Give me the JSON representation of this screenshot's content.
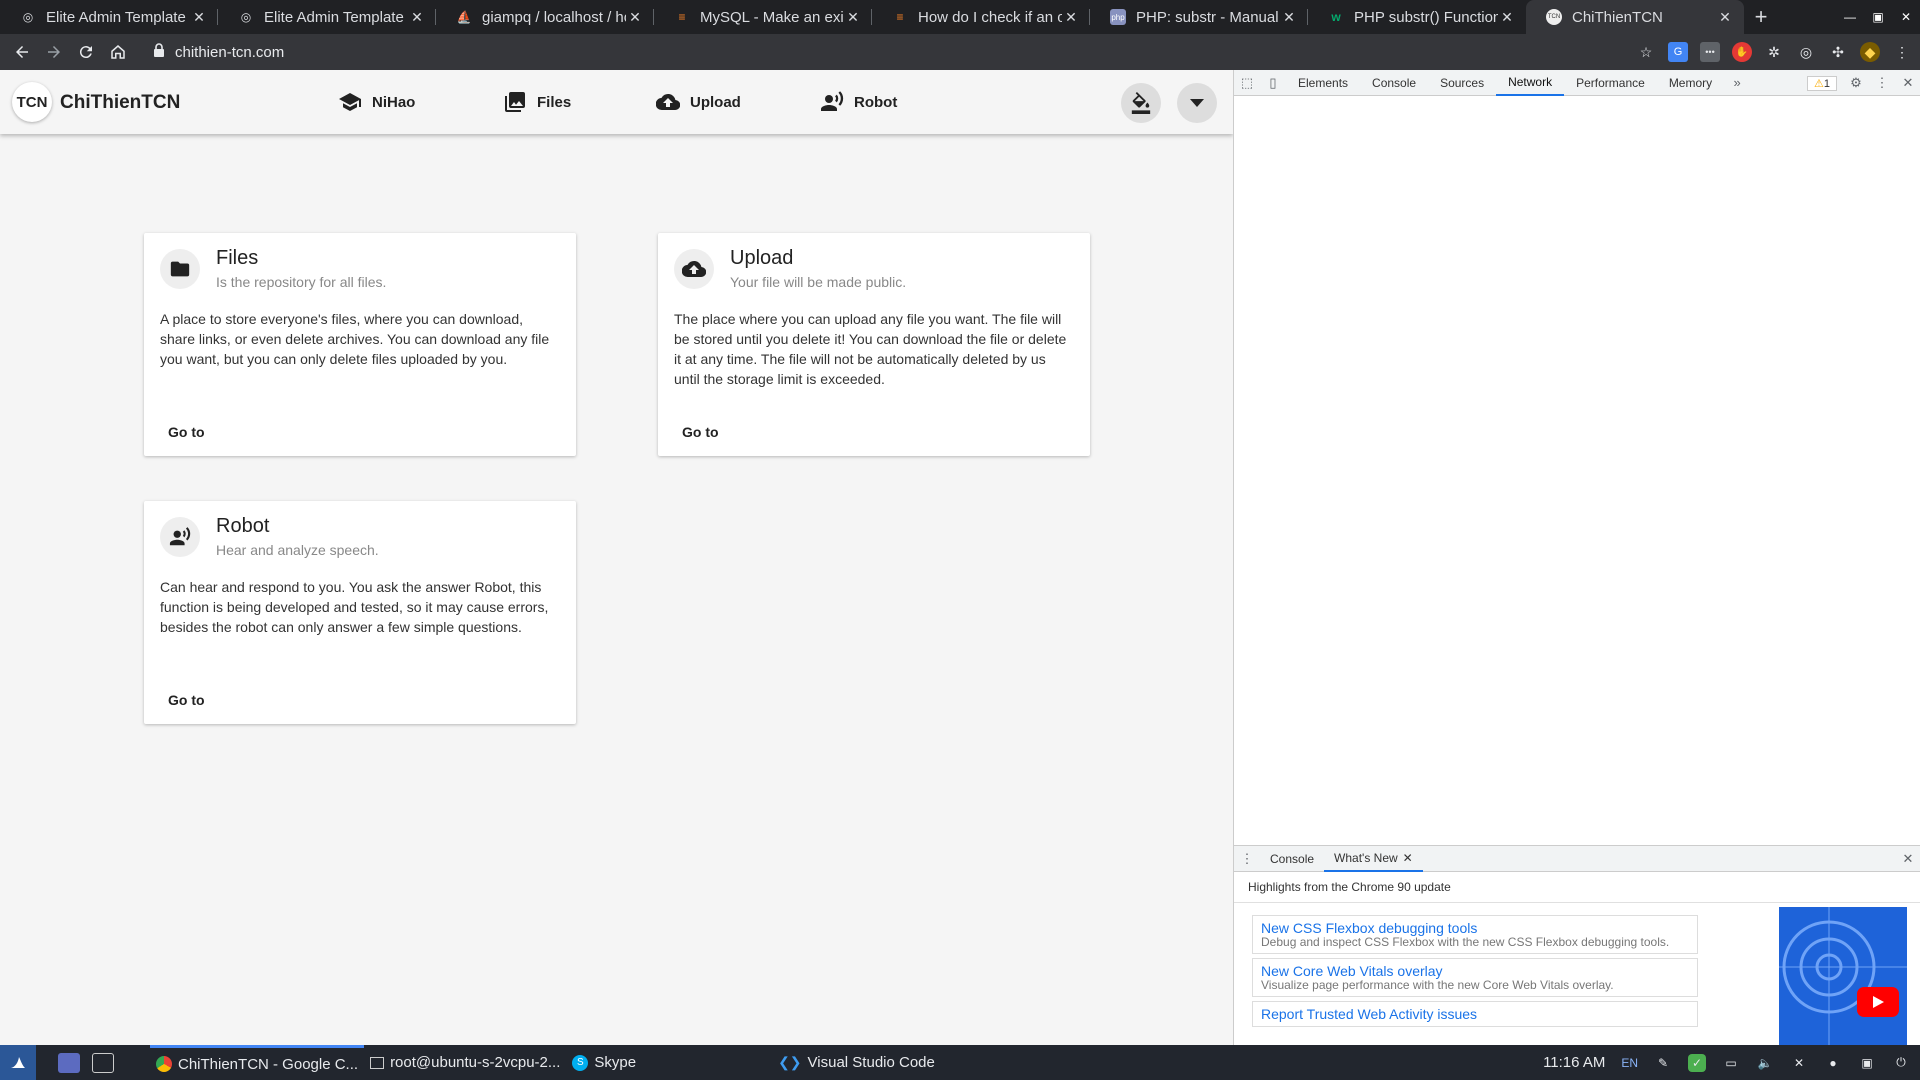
{
  "browser": {
    "tabs": [
      {
        "title": "Elite Admin Template -",
        "icon": "globe-icon"
      },
      {
        "title": "Elite Admin Template",
        "icon": "globe-icon"
      },
      {
        "title": "giampq / localhost / ho",
        "icon": "phpmyadmin-icon"
      },
      {
        "title": "MySQL - Make an exist",
        "icon": "stackoverflow-icon"
      },
      {
        "title": "How do I check if an ob",
        "icon": "stackoverflow-icon"
      },
      {
        "title": "PHP: substr - Manual",
        "icon": "php-icon"
      },
      {
        "title": "PHP substr() Function",
        "icon": "w3schools-icon"
      },
      {
        "title": "ChiThienTCN",
        "icon": "tcn-icon"
      }
    ],
    "url": "chithien-tcn.com"
  },
  "app": {
    "logo_text": "TCN",
    "brand": "ChiThienTCN",
    "nav": [
      {
        "label": "NiHao",
        "icon": "school-icon"
      },
      {
        "label": "Files",
        "icon": "photo-library-icon"
      },
      {
        "label": "Upload",
        "icon": "cloud-upload-icon"
      },
      {
        "label": "Robot",
        "icon": "record-voice-icon"
      }
    ],
    "cards": [
      {
        "title": "Files",
        "subtitle": "Is the repository for all files.",
        "body": "A place to store everyone's files, where you can download, share links, or even delete archives. You can download any file you want, but you can only delete files uploaded by you.",
        "button": "Go to",
        "icon": "folder-icon"
      },
      {
        "title": "Upload",
        "subtitle": "Your file will be made public.",
        "body": "The place where you can upload any file you want. The file will be stored until you delete it! You can download the file or delete it at any time. The file will not be automatically deleted by us until the storage limit is exceeded.",
        "button": "Go to",
        "icon": "cloud-upload-icon"
      },
      {
        "title": "Robot",
        "subtitle": "Hear and analyze speech.",
        "body": "Can hear and respond to you. You ask the answer Robot, this function is being developed and tested, so it may cause errors, besides the robot can only answer a few simple questions.",
        "button": "Go to",
        "icon": "record-voice-icon"
      }
    ]
  },
  "devtools": {
    "tabs": [
      "Elements",
      "Console",
      "Sources",
      "Network",
      "Performance",
      "Memory"
    ],
    "selected_tab": "Network",
    "more": "»",
    "warnings": "1",
    "drawer": {
      "tabs": [
        "Console",
        "What's New"
      ],
      "selected": "What's New",
      "heading": "Highlights from the Chrome 90 update",
      "news": [
        {
          "title": "New CSS Flexbox debugging tools",
          "desc": "Debug and inspect CSS Flexbox with the new CSS Flexbox debugging tools."
        },
        {
          "title": "New Core Web Vitals overlay",
          "desc": "Visualize page performance with the new Core Web Vitals overlay."
        },
        {
          "title": "Report Trusted Web Activity issues",
          "desc": ""
        }
      ]
    }
  },
  "taskbar": {
    "items": [
      {
        "label": "ChiThienTCN - Google C...",
        "icon": "chrome-icon"
      },
      {
        "label": "root@ubuntu-s-2vcpu-2...",
        "icon": "terminal-icon"
      },
      {
        "label": "Skype",
        "icon": "skype-icon"
      },
      {
        "label": "Visual Studio Code",
        "icon": "vscode-icon"
      }
    ],
    "time": "11:16 AM",
    "lang": "EN"
  },
  "colors": {
    "accent": "#1a73e8",
    "page_bg": "#f5f5f5",
    "chrome_dark": "#202124"
  }
}
